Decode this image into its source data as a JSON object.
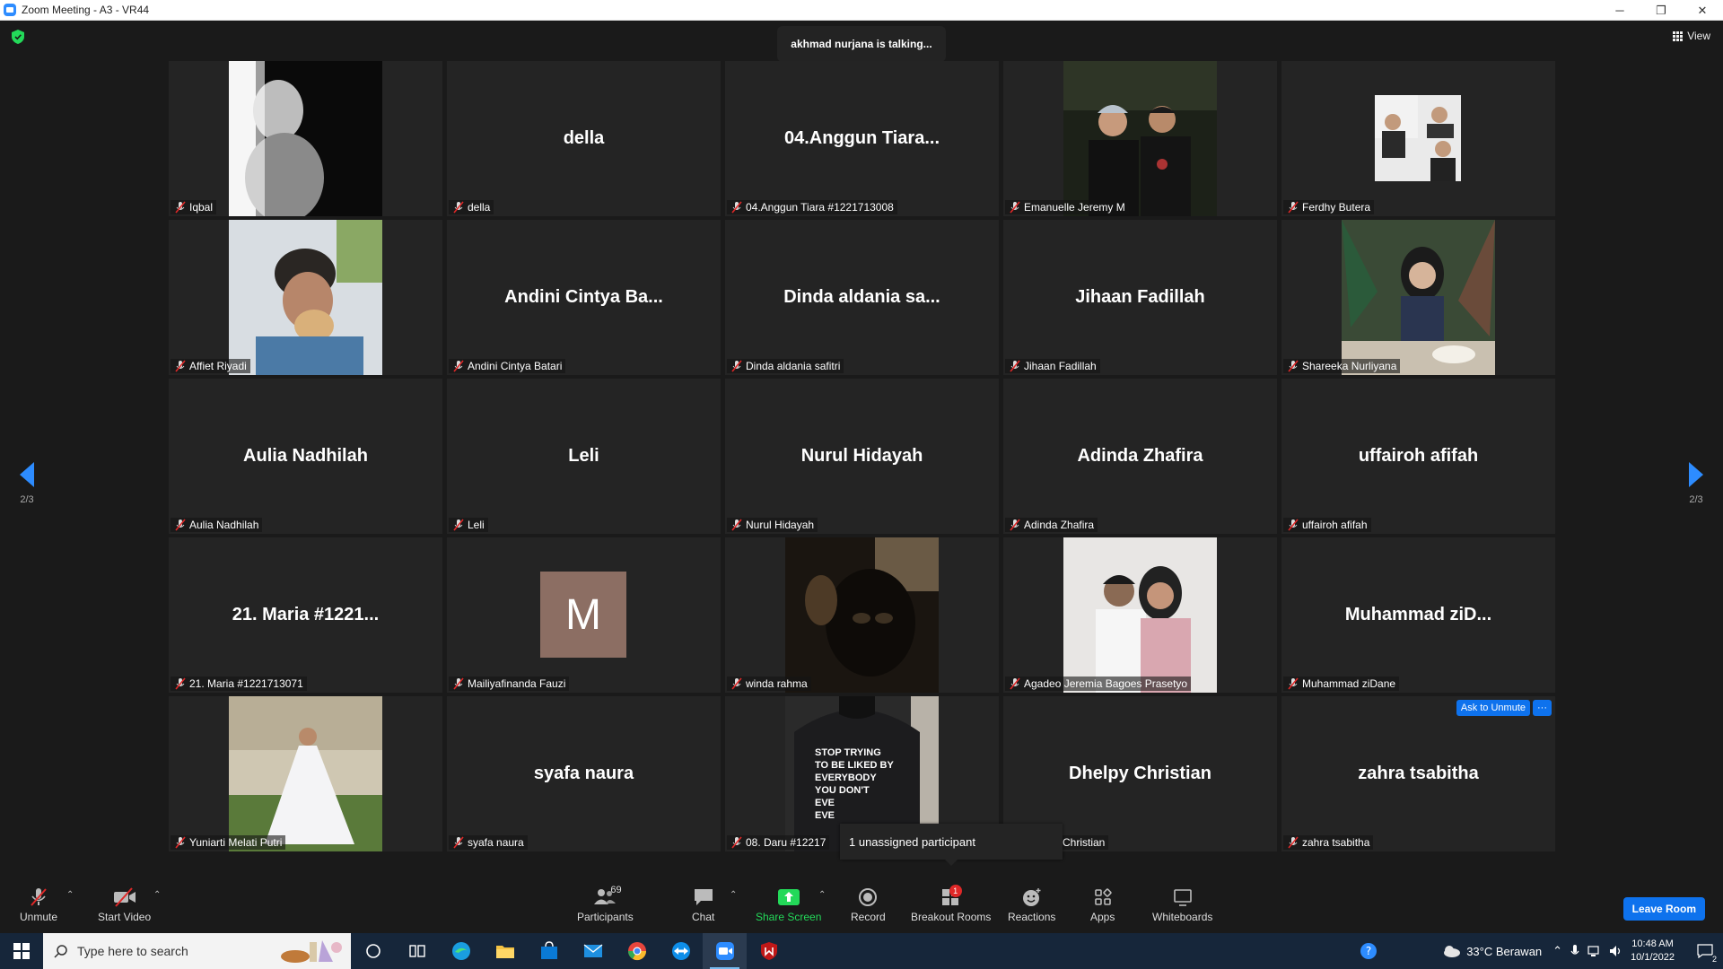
{
  "window": {
    "title": "Zoom Meeting - A3 - VR44",
    "minimize": "─",
    "restore": "❐",
    "close": "✕"
  },
  "meeting": {
    "talking_banner": "akhmad nurjana is talking...",
    "view_label": "View",
    "page_indicator_left": "2/3",
    "page_indicator_right": "2/3",
    "tooltip": "1 unassigned participant",
    "ask_to_unmute": "Ask to Unmute",
    "more": "···"
  },
  "tiles": [
    {
      "big": "",
      "label": "Iqbal",
      "video": "dark-silhouette"
    },
    {
      "big": "della",
      "label": "della"
    },
    {
      "big": "04.Anggun Tiara...",
      "label": "04.Anggun Tiara #1221713008"
    },
    {
      "big": "",
      "label": "Emanuelle Jeremy M",
      "video": "two-people-night"
    },
    {
      "big": "",
      "label": "Ferdhy Butera",
      "video": "small-collage"
    },
    {
      "big": "",
      "label": "Affiet Riyadi",
      "video": "person-light"
    },
    {
      "big": "Andini Cintya Ba...",
      "label": "Andini Cintya Batari"
    },
    {
      "big": "Dinda aldania sa...",
      "label": "Dinda aldania safitri"
    },
    {
      "big": "Jihaan Fadillah",
      "label": "Jihaan Fadillah"
    },
    {
      "big": "",
      "label": "Shareeka Nurliyana",
      "video": "woman-restaurant"
    },
    {
      "big": "Aulia Nadhilah",
      "label": "Aulia Nadhilah"
    },
    {
      "big": "Leli",
      "label": "Leli"
    },
    {
      "big": "Nurul Hidayah",
      "label": "Nurul Hidayah"
    },
    {
      "big": "Adinda Zhafira",
      "label": "Adinda Zhafira"
    },
    {
      "big": "uffairoh afifah",
      "label": "uffairoh afifah"
    },
    {
      "big": "21. Maria #1221...",
      "label": "21. Maria #1221713071"
    },
    {
      "big": "",
      "label": "Mailiyafinanda Fauzi",
      "avatar_letter": "M"
    },
    {
      "big": "",
      "label": "winda rahma",
      "video": "dark-cat"
    },
    {
      "big": "",
      "label": "Agadeo Jeremia Bagoes Prasetyo",
      "video": "couple-white"
    },
    {
      "big": "Muhammad ziD...",
      "label": "Muhammad ziDane"
    },
    {
      "big": "",
      "label": "Yuniarti Melati Putri",
      "video": "white-dress"
    },
    {
      "big": "syafa naura",
      "label": "syafa naura"
    },
    {
      "big": "",
      "label": "08. Daru #12217",
      "video": "hoodie-text"
    },
    {
      "big": "Dhelpy Christian",
      "label": "Christian"
    },
    {
      "big": "zahra tsabitha",
      "label": "zahra tsabitha"
    }
  ],
  "hoodie_text": [
    "STOP TRYING",
    "TO BE LIKED BY",
    "EVERYBODY",
    "YOU DON'T",
    "EVE",
    "EVE"
  ],
  "toolbar": {
    "unmute": "Unmute",
    "start_video": "Start Video",
    "participants": "Participants",
    "participants_count": "69",
    "chat": "Chat",
    "share_screen": "Share Screen",
    "record": "Record",
    "breakout_rooms": "Breakout Rooms",
    "breakout_badge": "1",
    "reactions": "Reactions",
    "apps": "Apps",
    "whiteboards": "Whiteboards",
    "leave": "Leave Room"
  },
  "taskbar": {
    "search_placeholder": "Type here to search",
    "weather": "33°C  Berawan",
    "time": "10:48 AM",
    "date": "10/1/2022",
    "notifications": "2"
  },
  "colors": {
    "accent": "#2d8cff",
    "share_green": "#23d959",
    "badge_red": "#e02828",
    "tile_bg": "#242424"
  }
}
